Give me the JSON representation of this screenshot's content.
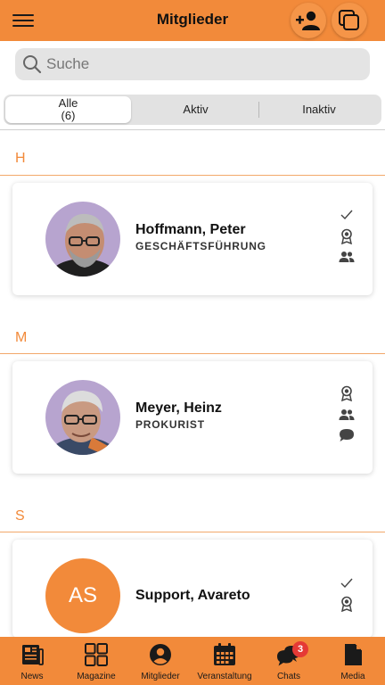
{
  "header": {
    "title": "Mitglieder"
  },
  "search": {
    "placeholder": "Suche"
  },
  "tabs": [
    {
      "label": "Alle",
      "count": "(6)"
    },
    {
      "label": "Aktiv"
    },
    {
      "label": "Inaktiv"
    }
  ],
  "sections": [
    {
      "letter": "H",
      "member": {
        "name": "Hoffmann, Peter",
        "role": "GESCHÄFTSFÜHRUNG"
      }
    },
    {
      "letter": "M",
      "member": {
        "name": "Meyer, Heinz",
        "role": "PROKURIST"
      }
    },
    {
      "letter": "S",
      "member": {
        "name": "Support, Avareto",
        "initials": "AS"
      }
    }
  ],
  "nav": [
    {
      "label": "News"
    },
    {
      "label": "Magazine"
    },
    {
      "label": "Mitglieder"
    },
    {
      "label": "Veranstaltung"
    },
    {
      "label": "Chats",
      "badge": "3"
    },
    {
      "label": "Media"
    }
  ],
  "colors": {
    "accent": "#f28a3a",
    "badge": "#e53935"
  }
}
